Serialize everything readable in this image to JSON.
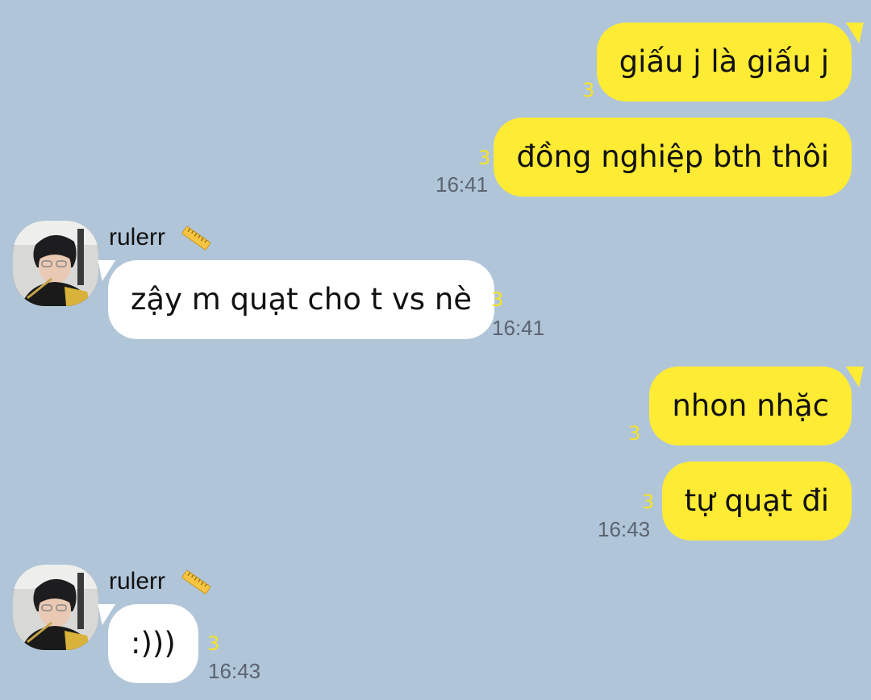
{
  "chat": {
    "sender_name": "rulerr",
    "sender_badge_icon": "ruler-emoji",
    "messages": [
      {
        "direction": "out",
        "text": "giấu j là giấu j",
        "unread": "3",
        "time": ""
      },
      {
        "direction": "out",
        "text": "đồng nghiệp bth thôi",
        "unread": "3",
        "time": "16:41"
      },
      {
        "direction": "in",
        "sender": "rulerr",
        "text": "zậy m quạt cho t vs nè",
        "unread": "3",
        "time": "16:41"
      },
      {
        "direction": "out",
        "text": "nhon nhặc",
        "unread": "3",
        "time": ""
      },
      {
        "direction": "out",
        "text": "tự quạt đi",
        "unread": "3",
        "time": "16:43"
      },
      {
        "direction": "in",
        "sender": "rulerr",
        "text": ":)))",
        "unread": "3",
        "time": "16:43"
      }
    ]
  },
  "colors": {
    "background": "#b1c5d9",
    "outgoing_bubble": "#feeb34",
    "incoming_bubble": "#ffffff",
    "unread_count": "#f6e224",
    "timestamp": "#5c6470"
  }
}
